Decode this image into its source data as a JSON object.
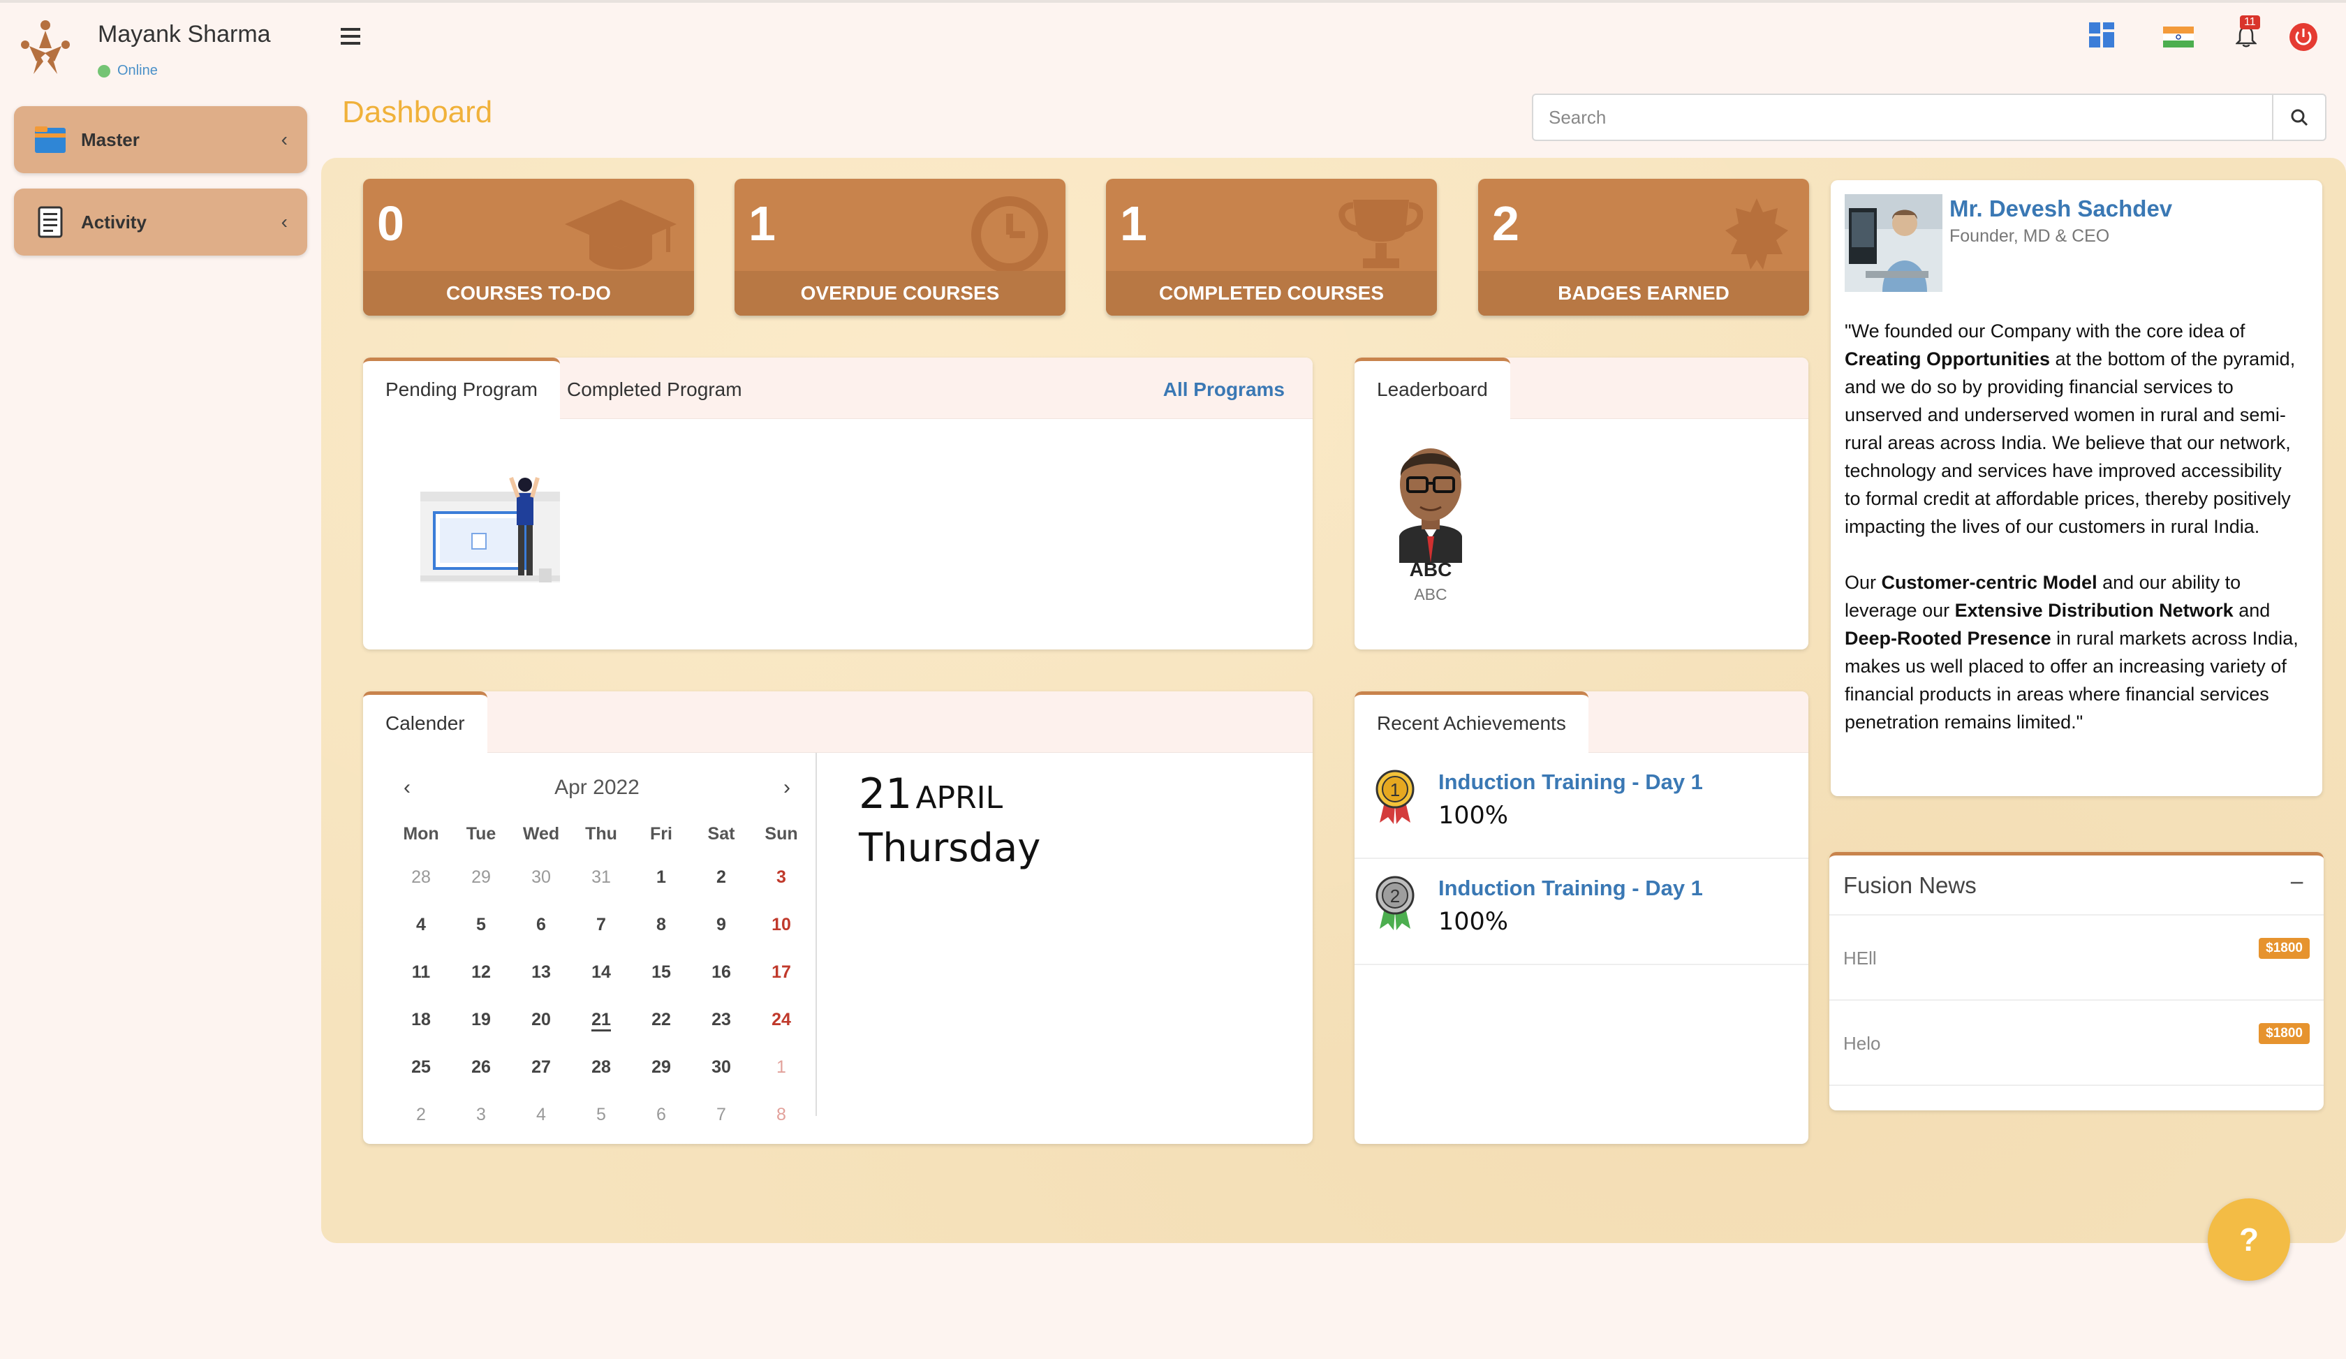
{
  "user": {
    "name": "Mayank Sharma",
    "status": "Online"
  },
  "sidebar": {
    "items": [
      {
        "label": "Master",
        "icon": "folder-icon"
      },
      {
        "label": "Activity",
        "icon": "notepad-icon"
      }
    ]
  },
  "header": {
    "title": "Dashboard",
    "search_placeholder": "Search",
    "notification_count": "11"
  },
  "stats": [
    {
      "value": "0",
      "label": "COURSES TO-DO",
      "icon": "graduation-cap-icon"
    },
    {
      "value": "1",
      "label": "OVERDUE COURSES",
      "icon": "clock-icon"
    },
    {
      "value": "1",
      "label": "COMPLETED COURSES",
      "icon": "trophy-icon"
    },
    {
      "value": "2",
      "label": "BADGES EARNED",
      "icon": "badge-icon"
    }
  ],
  "programs": {
    "tabs": [
      "Pending Program",
      "Completed Program"
    ],
    "link": "All Programs"
  },
  "leaderboard": {
    "tab": "Leaderboard",
    "name": "ABC",
    "subtitle": "ABC"
  },
  "calendar": {
    "tab": "Calender",
    "month_label": "Apr  2022",
    "weekdays": [
      "Mon",
      "Tue",
      "Wed",
      "Thu",
      "Fri",
      "Sat",
      "Sun"
    ],
    "weeks": [
      [
        "28",
        "29",
        "30",
        "31",
        "1",
        "2",
        "3"
      ],
      [
        "4",
        "5",
        "6",
        "7",
        "8",
        "9",
        "10"
      ],
      [
        "11",
        "12",
        "13",
        "14",
        "15",
        "16",
        "17"
      ],
      [
        "18",
        "19",
        "20",
        "21",
        "22",
        "23",
        "24"
      ],
      [
        "25",
        "26",
        "27",
        "28",
        "29",
        "30",
        "1"
      ],
      [
        "2",
        "3",
        "4",
        "5",
        "6",
        "7",
        "8"
      ]
    ],
    "selected_day": "21",
    "selected_month": "APRIL",
    "selected_weekday": "Thursday"
  },
  "achievements": {
    "tab": "Recent Achievements",
    "items": [
      {
        "title": "Induction Training - Day 1",
        "score": "100%",
        "medal": "gold-medal-icon",
        "rank": "1"
      },
      {
        "title": "Induction Training - Day 1",
        "score": "100%",
        "medal": "silver-medal-icon",
        "rank": "2"
      }
    ]
  },
  "founder": {
    "name": "Mr. Devesh Sachdev",
    "role": "Founder, MD & CEO",
    "p1_a": "\"We founded our Company with the core idea of ",
    "p1_b": "Creating Opportunities",
    "p1_c": " at the bottom of the pyramid, and we do so by providing financial services to unserved and underserved women in rural and semi-rural areas across India. We believe that our network, technology and services have improved accessibility to formal credit at affordable prices, thereby positively impacting the lives of our customers in rural India.",
    "p2_a": "Our ",
    "p2_b": "Customer-centric Model",
    "p2_c": " and our ability to leverage our ",
    "p2_d": "Extensive Distribution Network",
    "p2_e": " and ",
    "p2_f": "Deep-Rooted Presence",
    "p2_g": " in rural markets across India, makes us well placed to offer an increasing variety of financial products in areas where financial services penetration remains limited.\""
  },
  "news": {
    "title": "Fusion News",
    "collapse_symbol": "−",
    "items": [
      {
        "text": "HEll",
        "badge": "$1800"
      },
      {
        "text": "Helo",
        "badge": "$1800"
      }
    ]
  },
  "help": {
    "label": "?"
  },
  "colors": {
    "accent": "#c8834c",
    "title": "#f0b13a",
    "link": "#3a78b4",
    "sunday": "#c0392b",
    "help": "#f3bc45"
  }
}
